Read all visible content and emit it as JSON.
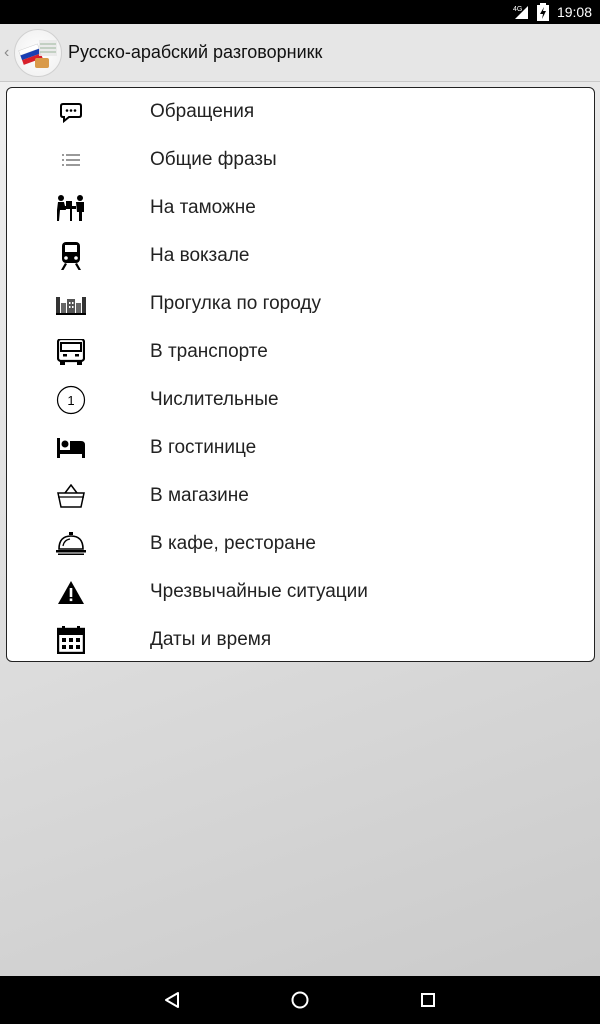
{
  "status_bar": {
    "network": "4G",
    "time": "19:08"
  },
  "action_bar": {
    "title": "Русско-арабский разговорникк"
  },
  "menu": {
    "items": [
      {
        "label": "Обращения",
        "icon": "speech-bubble-icon"
      },
      {
        "label": "Общие фразы",
        "icon": "list-icon"
      },
      {
        "label": "На таможне",
        "icon": "customs-icon"
      },
      {
        "label": "На вокзале",
        "icon": "train-icon"
      },
      {
        "label": "Прогулка по городу",
        "icon": "city-icon"
      },
      {
        "label": "В транспорте",
        "icon": "bus-icon"
      },
      {
        "label": "Числительные",
        "icon": "number-one-icon"
      },
      {
        "label": "В гостинице",
        "icon": "bed-icon"
      },
      {
        "label": "В магазине",
        "icon": "basket-icon"
      },
      {
        "label": "В кафе, ресторане",
        "icon": "cloche-icon"
      },
      {
        "label": "Чрезвычайные ситуации",
        "icon": "warning-icon"
      },
      {
        "label": "Даты и время",
        "icon": "calendar-icon"
      }
    ],
    "number_icon_text": "1"
  },
  "nav_bar": {
    "back": "back-triangle-icon",
    "home": "home-circle-icon",
    "recents": "recents-square-icon"
  }
}
